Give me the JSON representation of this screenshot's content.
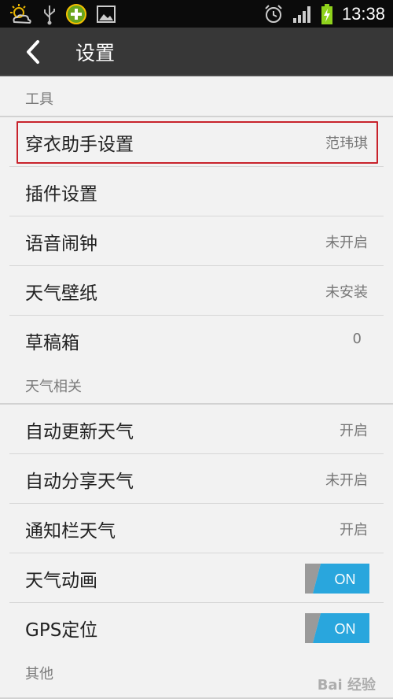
{
  "status_bar": {
    "time": "13:38",
    "icons_left": [
      "weather-sun-icon",
      "usb-icon",
      "app-plus-icon",
      "image-icon"
    ],
    "icons_right": [
      "alarm-icon",
      "signal-icon",
      "battery-charging-icon"
    ]
  },
  "header": {
    "title": "设置"
  },
  "sections": {
    "tools": "工具",
    "weather": "天气相关",
    "other": "其他"
  },
  "rows": {
    "dress": {
      "label": "穿衣助手设置",
      "value": "范玮琪"
    },
    "plugin": {
      "label": "插件设置"
    },
    "voice_alarm": {
      "label": "语音闹钟",
      "value": "未开启"
    },
    "wallpaper": {
      "label": "天气壁纸",
      "value": "未安装"
    },
    "drafts": {
      "label": "草稿箱",
      "value": "0"
    },
    "auto_update": {
      "label": "自动更新天气",
      "value": "开启"
    },
    "auto_share": {
      "label": "自动分享天气",
      "value": "未开启"
    },
    "notif_weather": {
      "label": "通知栏天气",
      "value": "开启"
    },
    "animation": {
      "label": "天气动画",
      "toggle": "ON"
    },
    "gps": {
      "label": "GPS定位",
      "toggle": "ON"
    }
  },
  "colors": {
    "toggle_on": "#29a6dd",
    "highlight": "#c8232c",
    "titlebar": "#373737"
  },
  "watermark": "Bai 经验"
}
